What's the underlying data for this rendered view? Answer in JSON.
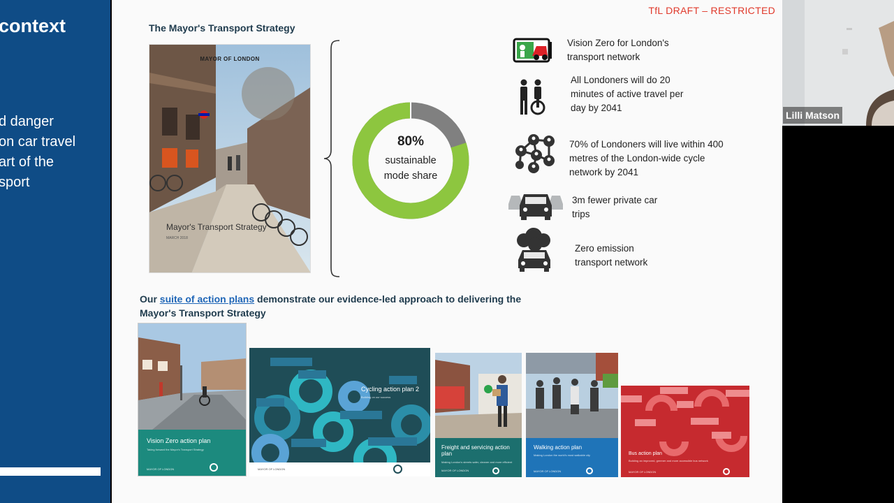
{
  "left_panel": {
    "title": "context",
    "lines": [
      "d danger",
      "on car travel",
      "art of the",
      "sport"
    ]
  },
  "slide": {
    "draft_tag": "TfL DRAFT – RESTRICTED",
    "mts_heading": "The Mayor's Transport Strategy",
    "cover": {
      "brand": "MAYOR OF LONDON",
      "title": "Mayor's Transport Strategy",
      "date": "MARCH 2018"
    },
    "donut": {
      "percent": "80%",
      "line1": "sustainable",
      "line2": "mode share",
      "share_value": 0.8,
      "color_main": "#8dc63f",
      "color_rest": "#808080"
    },
    "targets": [
      {
        "icon": "vision-zero-icon",
        "lines": [
          "Vision Zero for London's",
          "transport network"
        ]
      },
      {
        "icon": "active-travel-icon",
        "lines": [
          "All Londoners will do 20",
          "minutes of active travel per",
          "day by 2041"
        ]
      },
      {
        "icon": "cycle-network-icon",
        "lines": [
          "70% of Londoners will live within 400",
          "metres of the London-wide cycle",
          "network by 2041"
        ]
      },
      {
        "icon": "car-trips-icon",
        "lines": [
          "3m fewer private car",
          "trips"
        ]
      },
      {
        "icon": "zero-emission-icon",
        "lines": [
          "Zero emission",
          "transport network"
        ]
      }
    ],
    "action_intro": {
      "before": "Our ",
      "link": "suite of action plans",
      "after": " demonstrate our evidence-led approach to delivering the Mayor's Transport Strategy"
    },
    "plans": [
      {
        "title": "Vision Zero action plan",
        "subtitle": "Taking forward the Mayor's Transport Strategy",
        "footer": "MAYOR OF LONDON",
        "color": "#1c8a7e"
      },
      {
        "title": "Cycling action plan 2",
        "subtitle": "Building on our success",
        "footer": "MAYOR OF LONDON",
        "color": "#1f4d57"
      },
      {
        "title": "Freight and servicing action plan",
        "subtitle": "Making London's streets safer, cleaner and more efficient",
        "footer": "MAYOR OF LONDON",
        "color": "#1c6f6e"
      },
      {
        "title": "Walking action plan",
        "subtitle": "Making London the world's most walkable city",
        "footer": "MAYOR OF LONDON",
        "color": "#1f74b8"
      },
      {
        "title": "Bus action plan",
        "subtitle": "Building an improved, greener and more accessible bus network",
        "footer": "MAYOR OF LONDON",
        "color": "#c62a2f"
      }
    ]
  },
  "webcam": {
    "speaker_name": "Lilli Matson"
  }
}
